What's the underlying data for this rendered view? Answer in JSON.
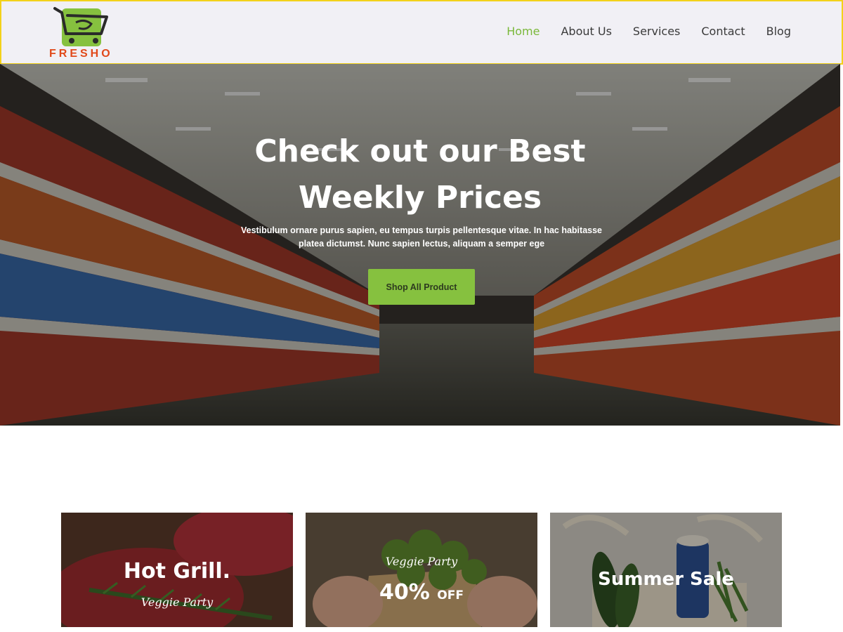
{
  "brand": {
    "name": "FRESHO",
    "colors": {
      "green": "#86c13f",
      "orange": "#e1491a",
      "header_border": "#f3d21a"
    }
  },
  "nav": {
    "items": [
      {
        "label": "Home",
        "active": true
      },
      {
        "label": "About Us",
        "active": false
      },
      {
        "label": "Services",
        "active": false
      },
      {
        "label": "Contact",
        "active": false
      },
      {
        "label": "Blog",
        "active": false
      }
    ]
  },
  "hero": {
    "title_line1": "Check out our Best",
    "title_line2": "Weekly Prices",
    "subtitle_line1": "Vestibulum ornare purus sapien, eu tempus turpis pellentesque vitae. In hac habitasse",
    "subtitle_line2": "platea dictumst. Nunc sapien lectus, aliquam a semper ege",
    "button_label": "Shop All Product"
  },
  "promos": [
    {
      "title": "Hot Grill.",
      "script": "Veggie Party"
    },
    {
      "script": "Veggie Party",
      "big": "40%",
      "small": "OFF"
    },
    {
      "title": "Summer Sale"
    }
  ]
}
